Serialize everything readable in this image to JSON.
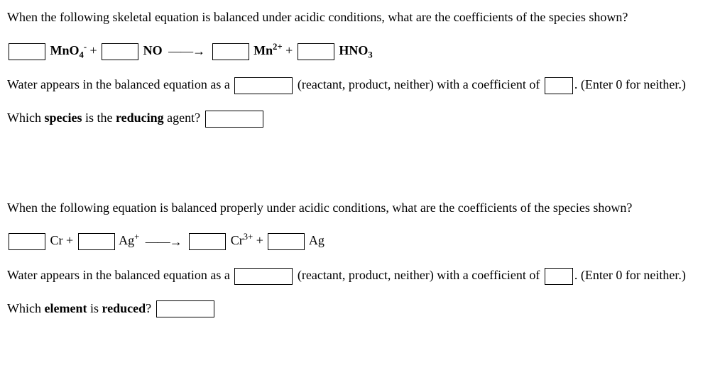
{
  "q1": {
    "prompt": "When the following skeletal equation is balanced under acidic conditions, what are the coefficients of the species shown?",
    "eq": {
      "s1_html": "MnO<sub>4</sub><sup>-</sup>",
      "plus1": "+",
      "s2_html": "NO",
      "arrow": "——→",
      "s3_html": "Mn<sup>2+</sup>",
      "plus2": "+",
      "s4_html": "HNO<sub>3</sub>"
    },
    "water_line_a": "Water appears in the balanced equation as a",
    "water_line_b": "(reactant, product, neither) with a coefficient of",
    "water_line_c": ". (Enter 0 for neither.)",
    "which_a": "Which ",
    "which_species": "species",
    "which_b": " is the ",
    "which_reducing": "reducing",
    "which_c": " agent?"
  },
  "q2": {
    "prompt": "When the following equation is balanced properly under acidic conditions, what are the coefficients of the species shown?",
    "eq": {
      "s1_html": "Cr",
      "plus1": "+",
      "s2_html": "Ag<sup>+</sup>",
      "arrow": "——→",
      "s3_html": "Cr<sup>3+</sup>",
      "plus2": "+",
      "s4_html": "Ag"
    },
    "water_line_a": "Water appears in the balanced equation as a",
    "water_line_b": "(reactant, product, neither) with a coefficient of",
    "water_line_c": ". (Enter 0 for neither.)",
    "which_a": "Which ",
    "which_element": "element",
    "which_b": " is ",
    "which_reduced": "reduced",
    "which_c": "?"
  }
}
